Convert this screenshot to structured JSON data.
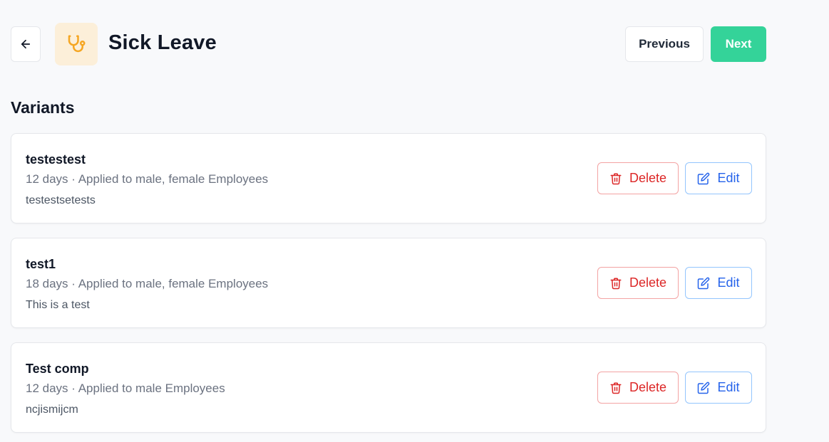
{
  "header": {
    "title": "Sick Leave",
    "back_icon": "arrow-left-icon",
    "leave_icon": "stethoscope-icon",
    "previous_label": "Previous",
    "next_label": "Next"
  },
  "colors": {
    "next_button": "#34d399",
    "icon_background": "#fcefd9",
    "icon_color": "#f5a623",
    "delete_color": "#dc2626",
    "edit_color": "#2563eb"
  },
  "variants_section": {
    "heading": "Variants",
    "items": [
      {
        "name": "testestest",
        "meta": "12 days · Applied to male, female Employees",
        "description": "testestsetests",
        "delete_label": "Delete",
        "edit_label": "Edit"
      },
      {
        "name": "test1",
        "meta": "18 days · Applied to male, female Employees",
        "description": "This is a test",
        "delete_label": "Delete",
        "edit_label": "Edit"
      },
      {
        "name": "Test comp",
        "meta": "12 days · Applied to male Employees",
        "description": "ncjismijcm",
        "delete_label": "Delete",
        "edit_label": "Edit"
      }
    ]
  }
}
